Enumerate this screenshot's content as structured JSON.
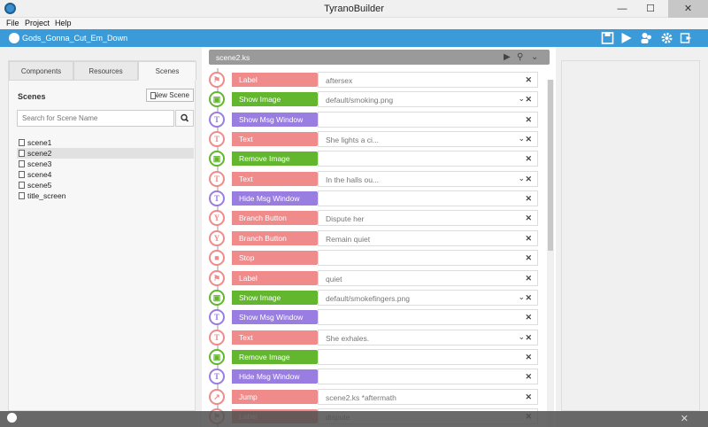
{
  "window": {
    "title": "TyranoBuilder",
    "minimize": "—",
    "maximize": "☐",
    "close": "✕"
  },
  "menu": [
    "File",
    "Project",
    "Help"
  ],
  "toolbar": {
    "project_name": "Gods_Gonna_Cut_Em_Down",
    "icons": [
      "save-icon",
      "play-icon",
      "characters-icon",
      "settings-icon",
      "export-icon"
    ]
  },
  "left_panel": {
    "tabs": [
      {
        "label": "Components",
        "active": false
      },
      {
        "label": "Resources",
        "active": false
      },
      {
        "label": "Scenes",
        "active": true
      }
    ],
    "heading": "Scenes",
    "new_scene_label": "New Scene",
    "search_placeholder": "Search for Scene Name",
    "scenes": [
      {
        "name": "scene1",
        "selected": false
      },
      {
        "name": "scene2",
        "selected": true
      },
      {
        "name": "scene3",
        "selected": false
      },
      {
        "name": "scene4",
        "selected": false
      },
      {
        "name": "scene5",
        "selected": false
      },
      {
        "name": "title_screen",
        "selected": false
      }
    ]
  },
  "editor": {
    "filename": "scene2.ks",
    "rows": [
      {
        "type": "Label",
        "value": "aftersex",
        "color": "#f08b8b",
        "icon": "flag-icon",
        "glyph": "⚑",
        "dropdown": false
      },
      {
        "type": "Show Image",
        "value": "default/smoking.png",
        "color": "#62b72e",
        "icon": "image-icon",
        "glyph": "▣",
        "dropdown": true
      },
      {
        "type": "Show Msg Window",
        "value": "",
        "color": "#9a7de0",
        "icon": "msg-window-icon",
        "glyph": "T",
        "dropdown": false
      },
      {
        "type": "Text",
        "value": "She lights a ci...",
        "color": "#f08b8b",
        "icon": "text-icon",
        "glyph": "T",
        "dropdown": true
      },
      {
        "type": "Remove Image",
        "value": "",
        "color": "#62b72e",
        "icon": "image-icon",
        "glyph": "▣",
        "dropdown": false
      },
      {
        "type": "Text",
        "value": "In the halls ou...",
        "color": "#f08b8b",
        "icon": "text-icon",
        "glyph": "T",
        "dropdown": true
      },
      {
        "type": "Hide Msg Window",
        "value": "",
        "color": "#9a7de0",
        "icon": "msg-window-icon",
        "glyph": "T",
        "dropdown": false
      },
      {
        "type": "Branch Button",
        "value": "Dispute her",
        "color": "#f08b8b",
        "icon": "branch-icon",
        "glyph": "Y",
        "dropdown": false
      },
      {
        "type": "Branch Button",
        "value": "Remain quiet",
        "color": "#f08b8b",
        "icon": "branch-icon",
        "glyph": "Y",
        "dropdown": false
      },
      {
        "type": "Stop",
        "value": "",
        "color": "#f08b8b",
        "icon": "stop-icon",
        "glyph": "■",
        "dropdown": false
      },
      {
        "type": "Label",
        "value": "quiet",
        "color": "#f08b8b",
        "icon": "flag-icon",
        "glyph": "⚑",
        "dropdown": false
      },
      {
        "type": "Show Image",
        "value": "default/smokefingers.png",
        "color": "#62b72e",
        "icon": "image-icon",
        "glyph": "▣",
        "dropdown": true
      },
      {
        "type": "Show Msg Window",
        "value": "",
        "color": "#9a7de0",
        "icon": "msg-window-icon",
        "glyph": "T",
        "dropdown": false
      },
      {
        "type": "Text",
        "value": "She exhales.",
        "color": "#f08b8b",
        "icon": "text-icon",
        "glyph": "T",
        "dropdown": true
      },
      {
        "type": "Remove Image",
        "value": "",
        "color": "#62b72e",
        "icon": "image-icon",
        "glyph": "▣",
        "dropdown": false
      },
      {
        "type": "Hide Msg Window",
        "value": "",
        "color": "#9a7de0",
        "icon": "msg-window-icon",
        "glyph": "T",
        "dropdown": false
      },
      {
        "type": "Jump",
        "value": "scene2.ks *aftermath",
        "color": "#f08b8b",
        "icon": "jump-icon",
        "glyph": "↗",
        "dropdown": false
      },
      {
        "type": "Label",
        "value": "dispute",
        "color": "#f08b8b",
        "icon": "flag-icon",
        "glyph": "⚑",
        "dropdown": false
      }
    ]
  },
  "colors": {
    "accent": "#3a9bd8",
    "pink": "#f08b8b",
    "green": "#62b72e",
    "purple": "#9a7de0"
  }
}
